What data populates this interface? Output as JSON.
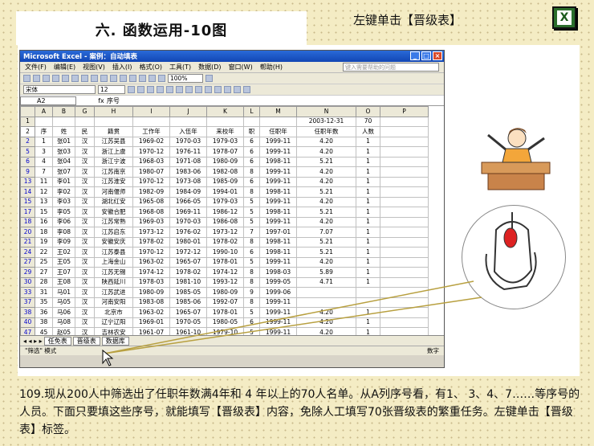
{
  "slide": {
    "title": "六. 函数运用-10图",
    "instruction": "左键单击【晋级表】",
    "bottom_text": "109.现从200人中筛选出了任职年数满4年和 4 年以上的70人名单。从A列序号看，有1、 3、4、7……等序号的人员。下面只要填这些序号，就能填写【晋级表】内容，免除人工填写70张晋级表的繁重任务。左键单击【晋级表】标签。"
  },
  "excel": {
    "window_title": "Microsoft Excel - 案例：自动填表",
    "menus": [
      "文件(F)",
      "编辑(E)",
      "视图(V)",
      "插入(I)",
      "格式(O)",
      "工具(T)",
      "数据(D)",
      "窗口(W)",
      "帮助(H)"
    ],
    "help_placeholder": "键入需要帮助的问题",
    "font_name": "宋体",
    "font_size": "12",
    "zoom": "100%",
    "name_box": "A2",
    "formula_text": "序号",
    "col_headers": [
      "A",
      "B",
      "G",
      "H",
      "I",
      "J",
      "K",
      "L",
      "M",
      "N",
      "O",
      "P"
    ],
    "row1": [
      "",
      "",
      "",
      "",
      "",
      "",
      "",
      "",
      "",
      "2003-12-31",
      "70",
      ""
    ],
    "header_row": [
      "序",
      "姓",
      "民",
      "籍贯",
      "工作年",
      "入伍年",
      "来校年",
      "职",
      "任职年",
      "任职年数",
      "人数",
      ""
    ],
    "rows": [
      [
        "2",
        "1",
        "张01",
        "汉",
        "江苏吴县",
        "1969-02",
        "1970-03",
        "1979-03",
        "6",
        "1999-11",
        "4.20",
        "1"
      ],
      [
        "5",
        "3",
        "张03",
        "汉",
        "浙江上虞",
        "1970-12",
        "1976-11",
        "1978-07",
        "6",
        "1999-11",
        "4.20",
        "1"
      ],
      [
        "6",
        "4",
        "张04",
        "汉",
        "浙江宁波",
        "1968-03",
        "1971-08",
        "1980-09",
        "6",
        "1998-11",
        "5.21",
        "1"
      ],
      [
        "9",
        "7",
        "张07",
        "汉",
        "江苏南京",
        "1980-07",
        "1983-06",
        "1982-08",
        "8",
        "1999-11",
        "4.20",
        "1"
      ],
      [
        "13",
        "11",
        "李01",
        "汉",
        "江苏淮安",
        "1970-12",
        "1973-08",
        "1985-09",
        "6",
        "1999-11",
        "4.20",
        "1"
      ],
      [
        "14",
        "12",
        "李02",
        "汉",
        "河南偃师",
        "1982-09",
        "1984-09",
        "1994-01",
        "8",
        "1998-11",
        "5.21",
        "1"
      ],
      [
        "15",
        "13",
        "李03",
        "汉",
        "湖北红安",
        "1965-08",
        "1966-05",
        "1979-03",
        "5",
        "1999-11",
        "4.20",
        "1"
      ],
      [
        "17",
        "15",
        "李05",
        "汉",
        "安徽合肥",
        "1968-08",
        "1969-11",
        "1986-12",
        "5",
        "1998-11",
        "5.21",
        "1"
      ],
      [
        "18",
        "16",
        "李06",
        "汉",
        "江苏常熟",
        "1969-03",
        "1970-03",
        "1986-08",
        "5",
        "1999-11",
        "4.20",
        "1"
      ],
      [
        "20",
        "18",
        "李08",
        "汉",
        "江苏启东",
        "1973-12",
        "1976-02",
        "1973-12",
        "7",
        "1997-01",
        "7.07",
        "1"
      ],
      [
        "21",
        "19",
        "李09",
        "汉",
        "安徽安庆",
        "1978-02",
        "1980-01",
        "1978-02",
        "8",
        "1998-11",
        "5.21",
        "1"
      ],
      [
        "24",
        "22",
        "王02",
        "汉",
        "江苏泰县",
        "1970-12",
        "1972-12",
        "1990-10",
        "6",
        "1998-11",
        "5.21",
        "1"
      ],
      [
        "27",
        "25",
        "王05",
        "汉",
        "上海金山",
        "1963-02",
        "1965-07",
        "1978-01",
        "5",
        "1999-11",
        "4.20",
        "1"
      ],
      [
        "29",
        "27",
        "王07",
        "汉",
        "江苏无锡",
        "1974-12",
        "1978-02",
        "1974-12",
        "8",
        "1998-03",
        "5.89",
        "1"
      ],
      [
        "30",
        "28",
        "王08",
        "汉",
        "陕西延川",
        "1978-03",
        "1981-10",
        "1993-12",
        "8",
        "1999-05",
        "4.71",
        "1"
      ],
      [
        "33",
        "31",
        "马01",
        "汉",
        "江苏武进",
        "1980-09",
        "1985-05",
        "1980-09",
        "9",
        "1999-06",
        "",
        ""
      ],
      [
        "37",
        "35",
        "马05",
        "汉",
        "河南安阳",
        "1983-08",
        "1985-06",
        "1992-07",
        "8",
        "1999-11",
        "",
        ""
      ],
      [
        "38",
        "36",
        "马06",
        "汉",
        "北京市",
        "1963-02",
        "1965-07",
        "1978-01",
        "5",
        "1999-11",
        "4.20",
        "1"
      ],
      [
        "40",
        "38",
        "马08",
        "汉",
        "辽宁辽阳",
        "1969-01",
        "1970-05",
        "1980-05",
        "6",
        "1999-11",
        "4.20",
        "1"
      ],
      [
        "47",
        "45",
        "赵05",
        "汉",
        "吉林农安",
        "1961-07",
        "1961-10",
        "1979-10",
        "5",
        "1999-11",
        "4.20",
        "1"
      ]
    ],
    "sheet_tabs": [
      "任免表",
      "晋级表",
      "数据库"
    ],
    "status_left": "\"筛选\" 模式",
    "status_right": "数字"
  }
}
